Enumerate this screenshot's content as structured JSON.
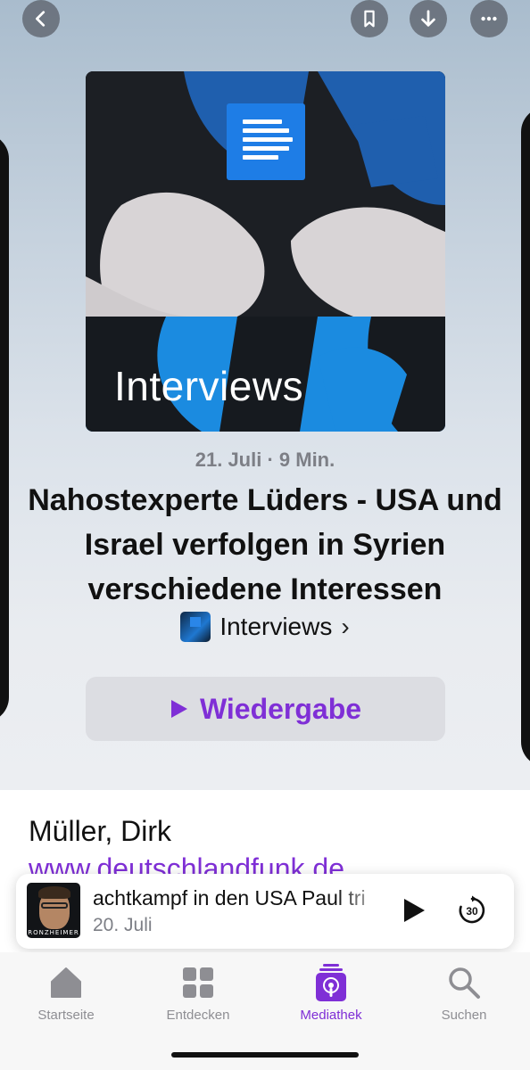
{
  "header": {
    "back_icon": "chevron-left-icon",
    "bookmark_icon": "bookmark-icon",
    "download_icon": "arrow-down-icon",
    "more_icon": "ellipsis-icon"
  },
  "artwork": {
    "title": "Interviews",
    "brand_color": "#1e7de6"
  },
  "episode": {
    "meta": "21. Juli · 9 Min.",
    "title": "Nahostexperte Lüders - USA und Israel verfolgen in Syrien verschiedene Interessen",
    "show_name": "Interviews",
    "show_chevron": "›"
  },
  "play_button": {
    "label": "Wiedergabe",
    "color": "#7f2fd6"
  },
  "description": {
    "author": "Müller, Dirk",
    "website": "www.deutschlandfunk.de"
  },
  "mini_player": {
    "thumb_label": "RONZHEIMER",
    "title": "achtkampf in den USA      Paul tri",
    "date": "20. Juli",
    "skip_label": "30"
  },
  "tabs": [
    {
      "label": "Startseite",
      "icon": "home-icon",
      "active": false
    },
    {
      "label": "Entdecken",
      "icon": "grid-icon",
      "active": false
    },
    {
      "label": "Mediathek",
      "icon": "library-icon",
      "active": true
    },
    {
      "label": "Suchen",
      "icon": "search-icon",
      "active": false
    }
  ],
  "colors": {
    "accent": "#7f2fd6",
    "inactive": "#8e8e93"
  }
}
